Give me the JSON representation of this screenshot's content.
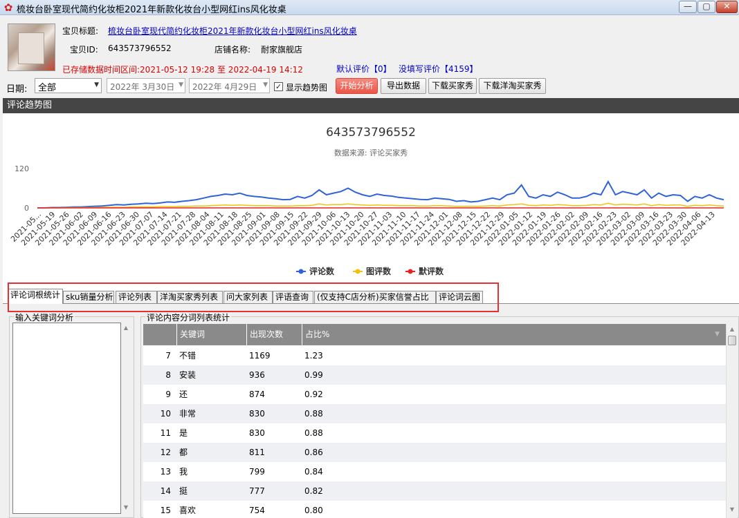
{
  "window": {
    "title": "梳妆台卧室现代简约化妆柜2021年新款化妆台小型网红ins风化妆桌",
    "min_glyph": "—",
    "max_glyph": "▢",
    "close_glyph": "✕"
  },
  "product": {
    "title_label": "宝贝标题:",
    "title_value": "梳妆台卧室现代简约化妆柜2021年新款化妆台小型网红ins风化妆桌",
    "id_label": "宝贝ID:",
    "id_value": "643573796552",
    "shop_label": "店铺名称:",
    "shop_value": "耐家旗舰店",
    "stored_range": "已存储数据时间区间:2021-05-12 19:28 至 2022-04-19 14:12",
    "default_reviews": "默认评价【0】",
    "unfilled_reviews": "没填写评价【4159】"
  },
  "toolbar": {
    "date_label": "日期:",
    "date_range": "全部",
    "start_date": "2022年 3月30日",
    "end_date": "2022年 4月29日",
    "show_trend_label": "显示趋势图",
    "show_trend_checked": true,
    "check_glyph": "✓",
    "analyze_btn": "开始分析",
    "export_btn": "导出数据",
    "download_buyer_btn": "下载买家秀",
    "download_yangtao_btn": "下载洋淘买家秀"
  },
  "trend_section": {
    "title": "评论趋势图"
  },
  "chart_data": {
    "type": "line",
    "title": "643573796552",
    "subtitle": "数据来源: 评论买家秀",
    "ylim": [
      0,
      120
    ],
    "yticks": [
      0,
      120
    ],
    "x_tick_labels": [
      "2021-05...",
      "2021-05-19",
      "2021-05-26",
      "2021-06-02",
      "2021-06-09",
      "2021-06-16",
      "2021-06-23",
      "2021-06-30",
      "2021-07-07",
      "2021-07-14",
      "2021-07-21",
      "2021-07-28",
      "2021-08-04",
      "2021-08-11",
      "2021-08-18",
      "2021-08-25",
      "2021-09-01",
      "2021-09-08",
      "2021-09-15",
      "2021-09-22",
      "2021-09-29",
      "2021-10-06",
      "2021-10-13",
      "2021-10-20",
      "2021-10-27",
      "2021-11-03",
      "2021-11-10",
      "2021-11-17",
      "2021-11-24",
      "2021-12-01",
      "2021-12-08",
      "2021-12-15",
      "2021-12-22",
      "2021-12-29",
      "2022-01-05",
      "2022-01-12",
      "2022-01-19",
      "2022-01-26",
      "2022-02-02",
      "2022-02-09",
      "2022-02-16",
      "2022-02-23",
      "2022-03-02",
      "2022-03-09",
      "2022-03-16",
      "2022-03-23",
      "2022-03-30",
      "2022-04-06",
      "2022-04-13"
    ],
    "legend_position": "bottom",
    "series": [
      {
        "name": "评论数",
        "color": "#2f62d8",
        "values": [
          0,
          0,
          1,
          1,
          2,
          3,
          3,
          4,
          5,
          6,
          8,
          10,
          9,
          11,
          12,
          14,
          13,
          15,
          18,
          17,
          20,
          22,
          25,
          30,
          35,
          38,
          42,
          40,
          45,
          38,
          35,
          33,
          30,
          28,
          25,
          26,
          35,
          30,
          38,
          55,
          40,
          45,
          50,
          60,
          48,
          40,
          35,
          42,
          38,
          36,
          32,
          30,
          28,
          26,
          25,
          30,
          28,
          26,
          20,
          22,
          18,
          20,
          25,
          30,
          25,
          40,
          45,
          70,
          35,
          30,
          40,
          35,
          48,
          40,
          30,
          30,
          35,
          45,
          40,
          80,
          40,
          50,
          45,
          40,
          55,
          30,
          45,
          35,
          40,
          38,
          20,
          35,
          30,
          40,
          30,
          25
        ]
      },
      {
        "name": "图评数",
        "color": "#f2c20a",
        "values": [
          0,
          0,
          0,
          0,
          1,
          1,
          1,
          1,
          1,
          2,
          2,
          2,
          2,
          3,
          3,
          3,
          3,
          4,
          4,
          4,
          5,
          5,
          6,
          6,
          7,
          8,
          9,
          8,
          9,
          8,
          7,
          7,
          7,
          6,
          6,
          6,
          7,
          7,
          8,
          12,
          9,
          10,
          10,
          12,
          10,
          9,
          8,
          9,
          8,
          8,
          7,
          7,
          7,
          6,
          6,
          7,
          7,
          6,
          5,
          5,
          5,
          5,
          6,
          7,
          6,
          9,
          10,
          12,
          8,
          7,
          9,
          8,
          10,
          9,
          7,
          7,
          8,
          10,
          9,
          14,
          9,
          11,
          10,
          9,
          12,
          7,
          10,
          8,
          9,
          9,
          5,
          8,
          7,
          9,
          7,
          6
        ]
      },
      {
        "name": "默评数",
        "color": "#e52222",
        "values": [
          0,
          0,
          0,
          0,
          0,
          0,
          0,
          0,
          0,
          0,
          0,
          0,
          0,
          0,
          0,
          0,
          0,
          0,
          0,
          0,
          0,
          0,
          0,
          0,
          0,
          0,
          0,
          0,
          0,
          0,
          0,
          0,
          0,
          0,
          0,
          0,
          0,
          0,
          0,
          0,
          0,
          0,
          0,
          0,
          0,
          0,
          0,
          0,
          0,
          0,
          0,
          0,
          0,
          0,
          0,
          0,
          0,
          0,
          0,
          0,
          0,
          0,
          0,
          0,
          0,
          0,
          0,
          0,
          0,
          0,
          0,
          0,
          0,
          0,
          0,
          0,
          0,
          0,
          0,
          0,
          0,
          0,
          0,
          0,
          0,
          0,
          0,
          0,
          0,
          0,
          0,
          0,
          0,
          0,
          0,
          0
        ]
      }
    ]
  },
  "tabs": [
    {
      "label": "评论词根统计",
      "active": true
    },
    {
      "label": "sku销量分析",
      "active": false
    },
    {
      "label": "评论列表",
      "active": false
    },
    {
      "label": "洋淘买家秀列表",
      "active": false
    },
    {
      "label": "问大家列表",
      "active": false
    },
    {
      "label": "评语查询",
      "active": false
    },
    {
      "label": "(仅支持C店分析)买家信誉占比",
      "active": false
    },
    {
      "label": "评论词云图",
      "active": false
    }
  ],
  "keyword_panel": {
    "title": "输入关键词分析",
    "value": ""
  },
  "stats_panel": {
    "title": "评论内容分词列表统计",
    "columns": [
      "",
      "关键词",
      "出现次数",
      "占比%"
    ],
    "rows": [
      {
        "rank": "7",
        "word": "不错",
        "count": "1169",
        "pct": "1.23"
      },
      {
        "rank": "8",
        "word": "安装",
        "count": "936",
        "pct": "0.99"
      },
      {
        "rank": "9",
        "word": "还",
        "count": "874",
        "pct": "0.92"
      },
      {
        "rank": "10",
        "word": "非常",
        "count": "830",
        "pct": "0.88"
      },
      {
        "rank": "11",
        "word": "是",
        "count": "830",
        "pct": "0.88"
      },
      {
        "rank": "12",
        "word": "都",
        "count": "811",
        "pct": "0.86"
      },
      {
        "rank": "13",
        "word": "我",
        "count": "799",
        "pct": "0.84"
      },
      {
        "rank": "14",
        "word": "挺",
        "count": "777",
        "pct": "0.82"
      },
      {
        "rank": "15",
        "word": "喜欢",
        "count": "754",
        "pct": "0.80"
      }
    ]
  }
}
